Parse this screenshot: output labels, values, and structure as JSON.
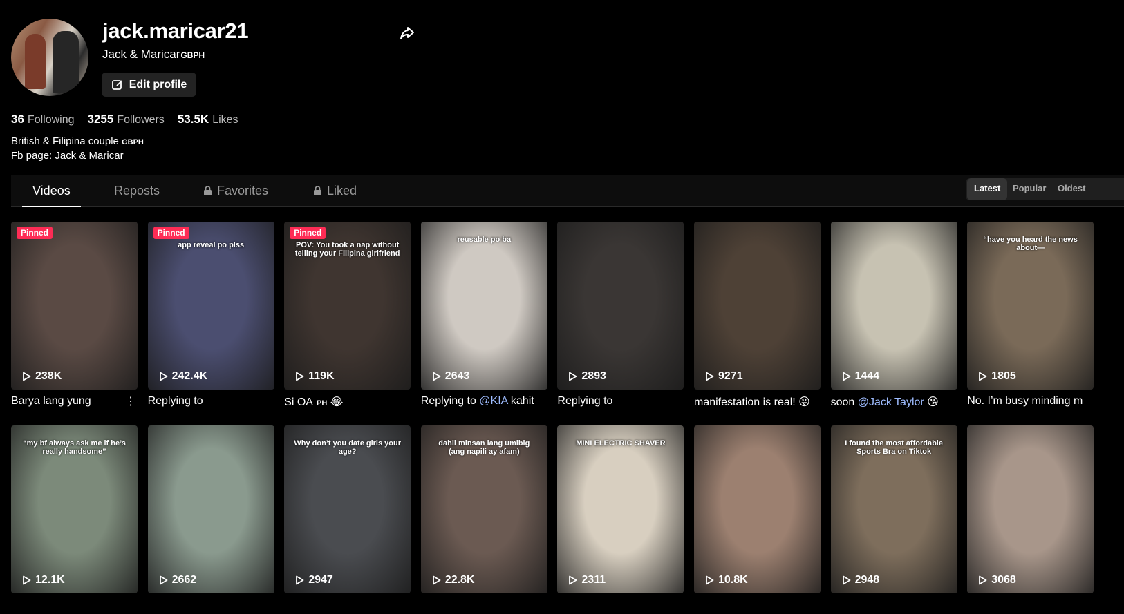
{
  "profile": {
    "username": "jack.maricar21",
    "display_name": "Jack & Maricar",
    "display_name_flag": "GBPH",
    "edit_label": "Edit profile",
    "stats": [
      {
        "value": "36",
        "label": "Following"
      },
      {
        "value": "3255",
        "label": "Followers"
      },
      {
        "value": "53.5K",
        "label": "Likes"
      }
    ],
    "bio_line1": "British & Filipina couple",
    "bio_line1_flag": "GBPH",
    "bio_line2": "Fb page: Jack & Maricar"
  },
  "tabs": [
    {
      "label": "Videos",
      "icon": ""
    },
    {
      "label": "Reposts",
      "icon": ""
    },
    {
      "label": "Favorites",
      "icon": "lock-icon"
    },
    {
      "label": "Liked",
      "icon": "lock-icon"
    }
  ],
  "sort": [
    "Latest",
    "Popular",
    "Oldest"
  ],
  "pinned_label": "Pinned",
  "videos": [
    {
      "views": "238K",
      "caption": "Barya lang yung",
      "bg": "#5a4a44",
      "pinned": true
    },
    {
      "views": "242.4K",
      "caption": "Replying to",
      "bg": "#4b4e70",
      "pinned": true,
      "overlay": "app reveal po plss"
    },
    {
      "views": "119K",
      "caption": "Si OA",
      "caption_flag": "PH",
      "caption_emoji": "😂",
      "bg": "#3f3530",
      "pinned": true,
      "overlay": "POV: You took a nap without telling your Filipina girlfriend"
    },
    {
      "views": "2643",
      "caption": "Replying to",
      "mention": "@KIA",
      "caption_after": "kahit",
      "bg": "#cfc9c2",
      "overlay": "reusable po ba"
    },
    {
      "views": "2893",
      "caption": "Replying to",
      "bg": "#3a3634"
    },
    {
      "views": "9271",
      "caption": "manifestation is real!",
      "caption_emoji": "😝",
      "bg": "#4e4136"
    },
    {
      "views": "1444",
      "caption": "soon",
      "mention": "@Jack Taylor",
      "caption_emoji": "😘",
      "bg": "#c7c2b2"
    },
    {
      "views": "1805",
      "caption": "No. I’m busy minding m",
      "bg": "#7a6a58",
      "overlay": "“have you heard the news about—"
    },
    {
      "views": "12.1K",
      "caption": "",
      "bg": "#7c8a7a",
      "overlay": "“my bf always ask me if he’s really handsome”"
    },
    {
      "views": "2662",
      "caption": "",
      "bg": "#8a9a8e"
    },
    {
      "views": "2947",
      "caption": "",
      "bg": "#4a4c50",
      "overlay": "Why don’t you date girls your age?"
    },
    {
      "views": "22.8K",
      "caption": "",
      "bg": "#6b5a52",
      "overlay": "dahil minsan lang umibig (ang napili ay afam)"
    },
    {
      "views": "2311",
      "caption": "",
      "bg": "#d8cfc0",
      "overlay": "MINI ELECTRIC SHAVER"
    },
    {
      "views": "10.8K",
      "caption": "",
      "bg": "#9c8070"
    },
    {
      "views": "2948",
      "caption": "",
      "bg": "#7e6e5c",
      "overlay": "I found the most affordable Sports Bra on Tiktok"
    },
    {
      "views": "3068",
      "caption": "",
      "bg": "#a8968a"
    }
  ]
}
